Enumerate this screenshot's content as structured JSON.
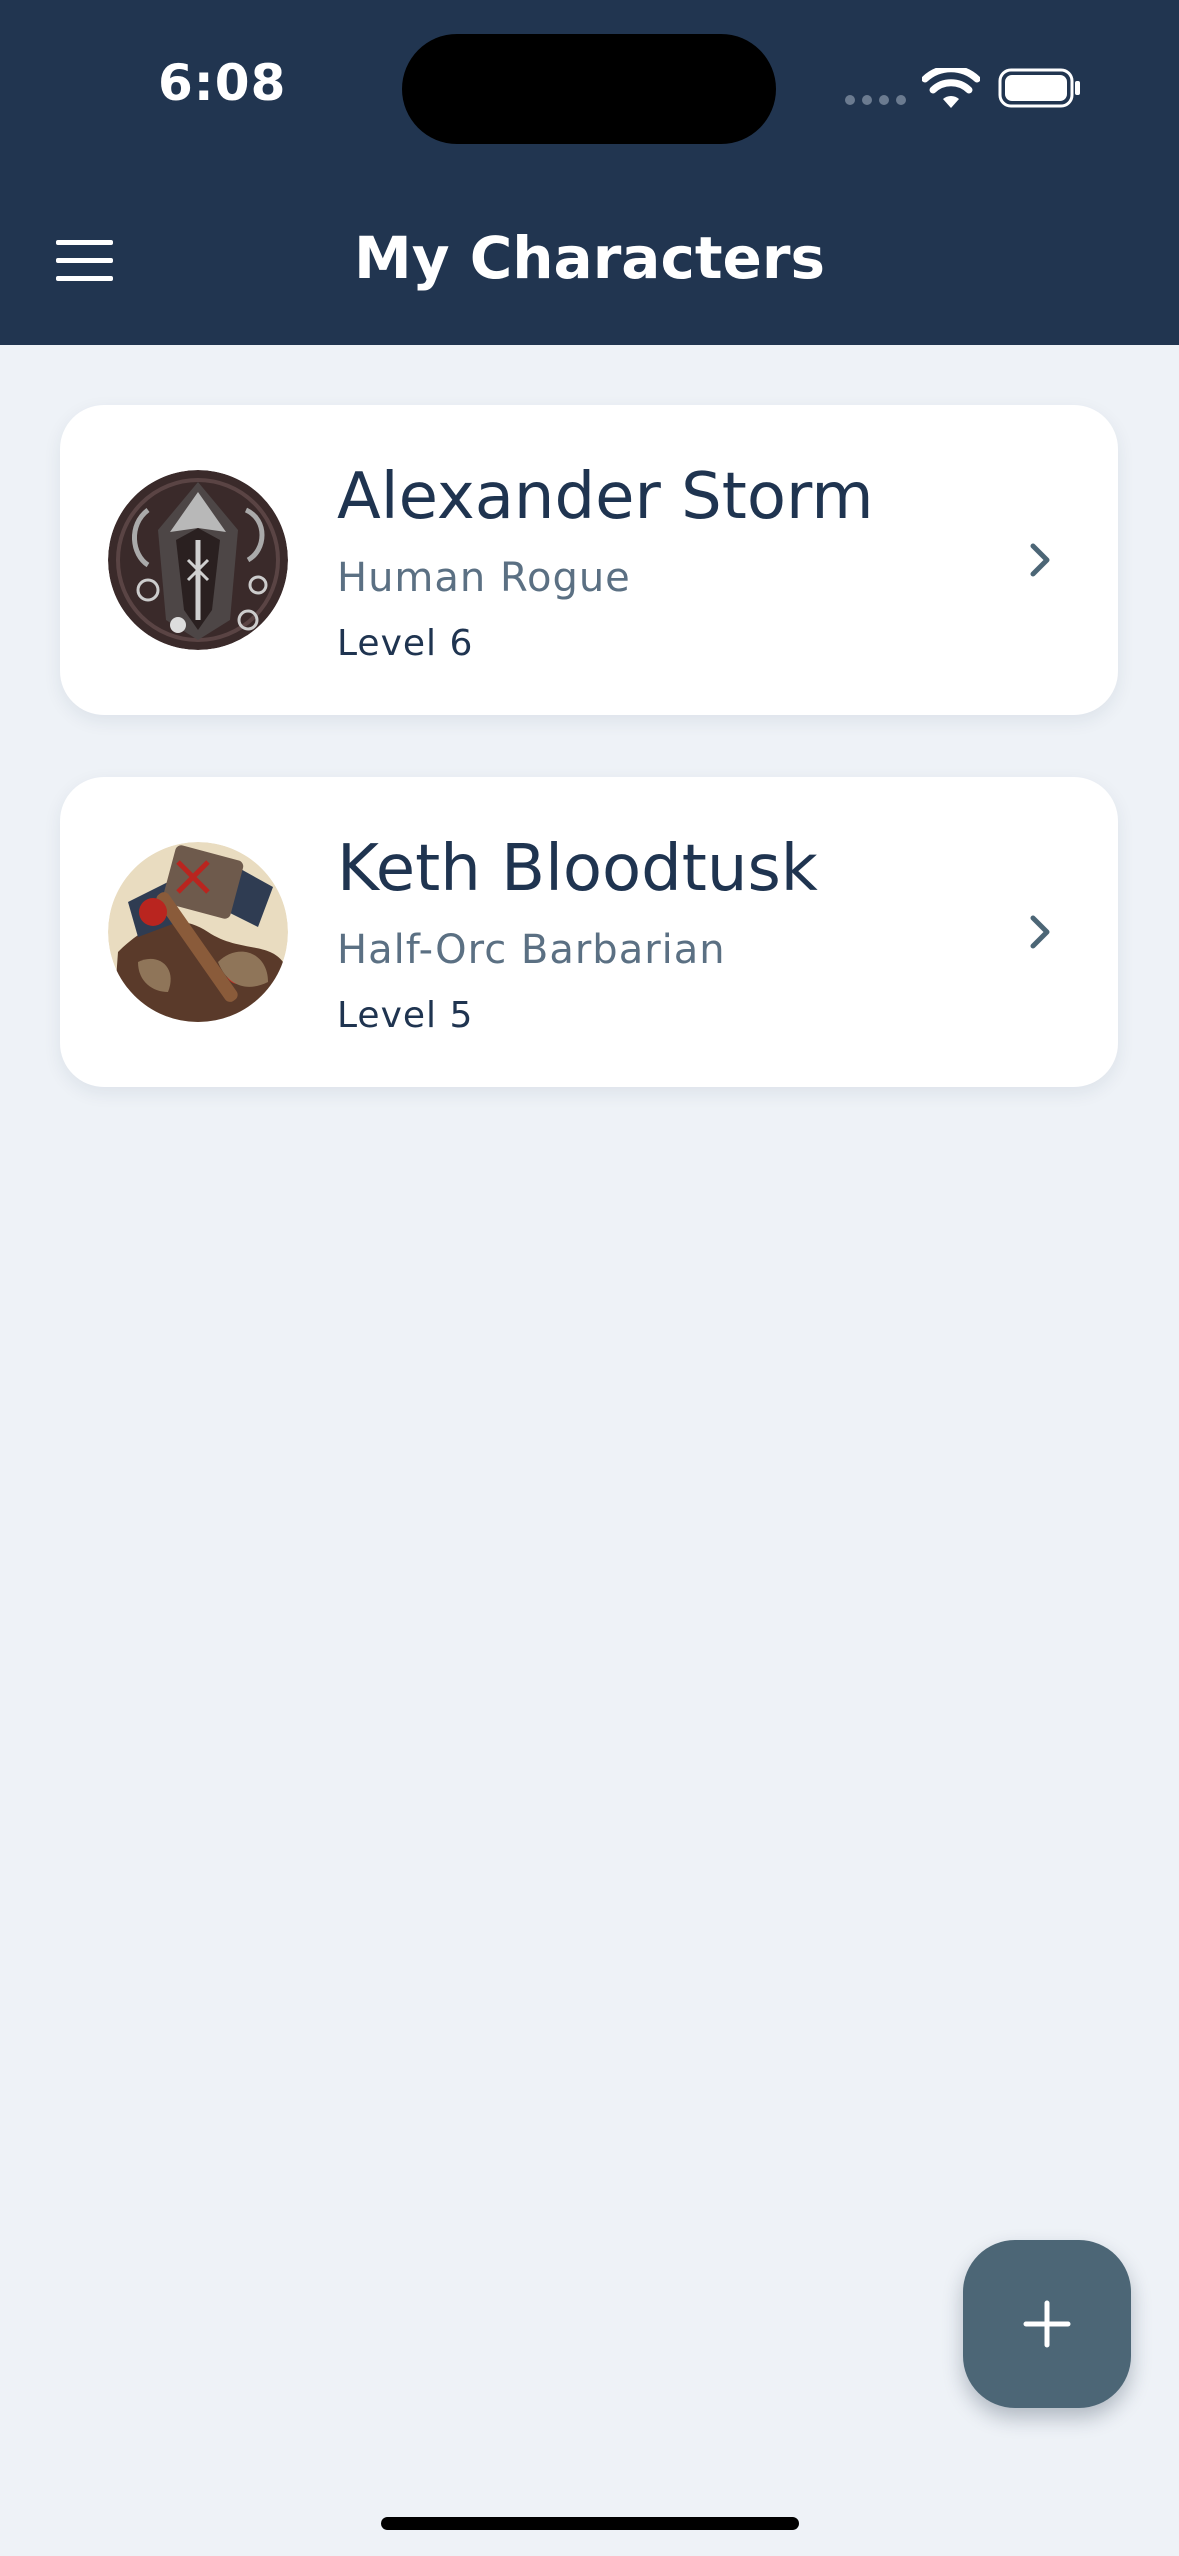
{
  "status_bar": {
    "time": "6:08"
  },
  "header": {
    "title": "My Characters",
    "menu_icon": "hamburger-menu-icon"
  },
  "characters": [
    {
      "name": "Alexander Storm",
      "class": "Human Rogue",
      "level": "Level 6",
      "avatar": "hooded-rogue-portrait"
    },
    {
      "name": "Keth Bloodtusk",
      "class": "Half-Orc Barbarian",
      "level": "Level 5",
      "avatar": "barbarian-axe-portrait"
    }
  ],
  "fab": {
    "icon": "plus-icon"
  },
  "colors": {
    "header_bg": "#213550",
    "page_bg": "#eef2f7",
    "card_bg": "#ffffff",
    "name_text": "#1f3450",
    "class_text": "#5b7083",
    "fab_bg": "#4c6676"
  }
}
